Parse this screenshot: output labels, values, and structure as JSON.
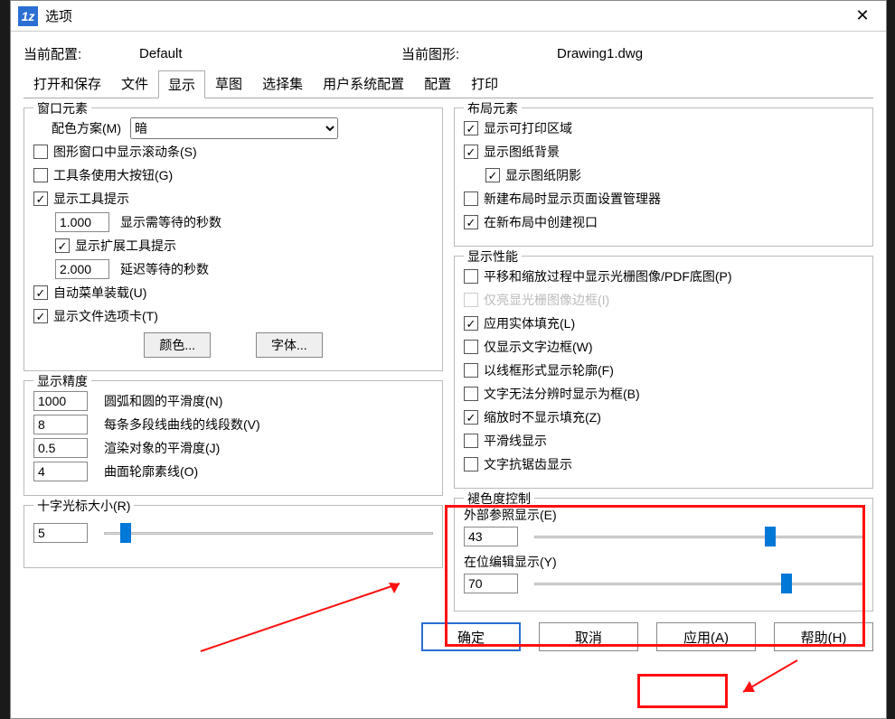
{
  "window": {
    "title": "选项"
  },
  "info": {
    "label_profile": "当前配置:",
    "value_profile": "Default",
    "label_drawing": "当前图形:",
    "value_drawing": "Drawing1.dwg"
  },
  "tabs": [
    "打开和保存",
    "文件",
    "显示",
    "草图",
    "选择集",
    "用户系统配置",
    "配置",
    "打印"
  ],
  "active_tab": 2,
  "window_elements": {
    "legend": "窗口元素",
    "colorscheme_label": "配色方案(M)",
    "colorscheme_value": "暗",
    "scrollbars": "图形窗口中显示滚动条(S)",
    "large_buttons": "工具条使用大按钮(G)",
    "tooltips": "显示工具提示",
    "wait_secs_value": "1.000",
    "wait_secs_label": "显示需等待的秒数",
    "ext_tooltips": "显示扩展工具提示",
    "delay_secs_value": "2.000",
    "delay_secs_label": "延迟等待的秒数",
    "autoload": "自动菜单装载(U)",
    "filetab": "显示文件选项卡(T)",
    "color_btn": "颜色...",
    "font_btn": "字体..."
  },
  "display_accuracy": {
    "legend": "显示精度",
    "arc_value": "1000",
    "arc_label": "圆弧和圆的平滑度(N)",
    "seg_value": "8",
    "seg_label": "每条多段线曲线的线段数(V)",
    "render_value": "0.5",
    "render_label": "渲染对象的平滑度(J)",
    "surf_value": "4",
    "surf_label": "曲面轮廓素线(O)"
  },
  "crosshair": {
    "legend": "十字光标大小(R)",
    "value": "5",
    "slider_percent": 5
  },
  "layout_elements": {
    "legend": "布局元素",
    "print_area": "显示可打印区域",
    "paper_bg": "显示图纸背景",
    "paper_shadow": "显示图纸阴影",
    "new_layout_pagesetup": "新建布局时显示页面设置管理器",
    "viewport_new": "在新布局中创建视口"
  },
  "display_perf": {
    "legend": "显示性能",
    "pan_zoom": "平移和缩放过程中显示光栅图像/PDF底图(P)",
    "highlight_frame": "仅亮显光栅图像边框(I)",
    "solid_fill": "应用实体填充(L)",
    "text_frame": "仅显示文字边框(W)",
    "wireframe": "以线框形式显示轮廓(F)",
    "degrade_text": "文字无法分辨时显示为框(B)",
    "no_fill_zoom": "缩放时不显示填充(Z)",
    "smooth_line": "平滑线显示",
    "antialias_text": "文字抗锯齿显示"
  },
  "fade_control": {
    "legend": "褪色度控制",
    "xref_label": "外部参照显示(E)",
    "xref_value": "43",
    "xref_percent": 70,
    "inplace_label": "在位编辑显示(Y)",
    "inplace_value": "70",
    "inplace_percent": 75
  },
  "buttons": {
    "ok": "确定",
    "cancel": "取消",
    "apply": "应用(A)",
    "help": "帮助(H)"
  }
}
